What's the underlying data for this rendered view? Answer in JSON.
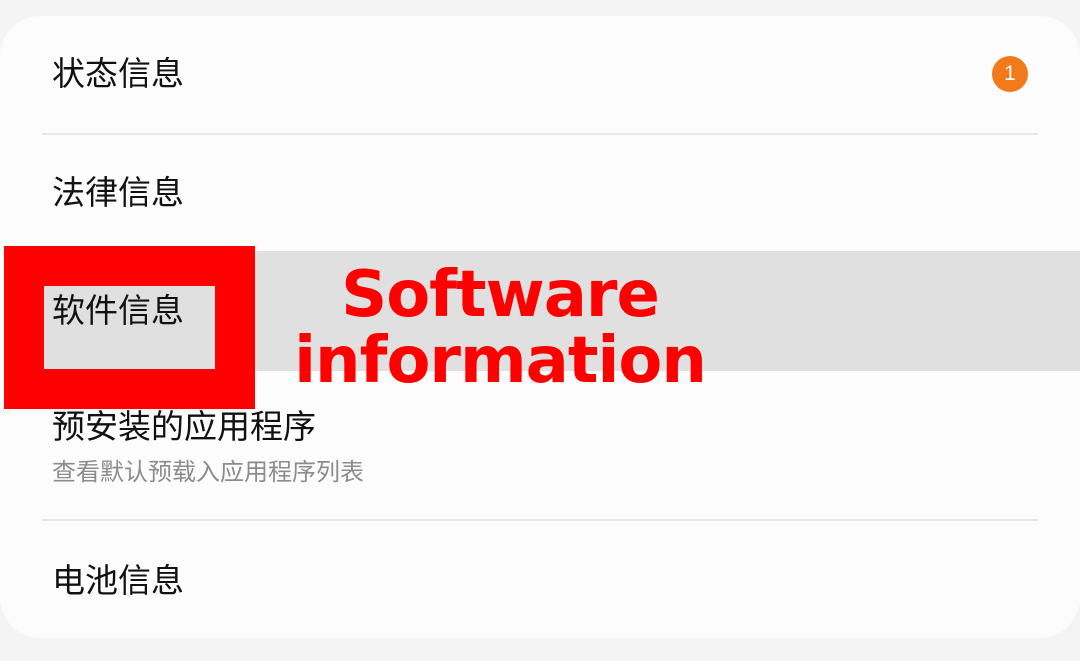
{
  "settings_list": {
    "items": [
      {
        "title": "状态信息",
        "badge": "1"
      },
      {
        "title": "法律信息"
      },
      {
        "title": "软件信息"
      },
      {
        "title": "预安装的应用程序",
        "subtitle": "查看默认预载入应用程序列表"
      },
      {
        "title": "电池信息"
      }
    ]
  },
  "annotation": {
    "line1": "Software",
    "line2": "information",
    "color": "#ff0000"
  },
  "colors": {
    "badge": "#f27a1a",
    "highlight": "#e0e0e0"
  }
}
